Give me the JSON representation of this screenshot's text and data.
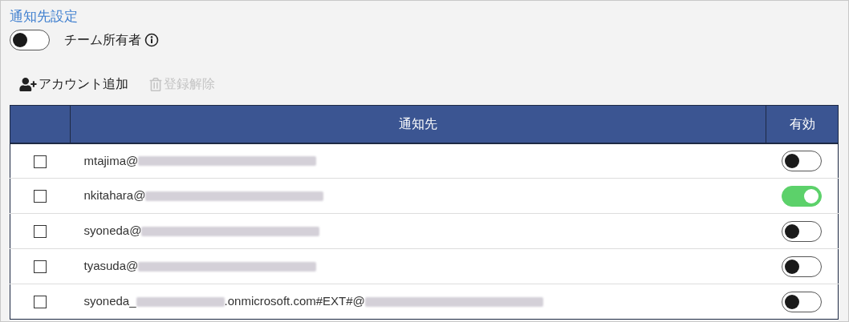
{
  "title": "通知先設定",
  "team_owner": {
    "label": "チーム所有者",
    "on": false
  },
  "toolbar": [
    {
      "label": "アカウント追加",
      "kind": "add",
      "disabled": false
    },
    {
      "label": "登録解除",
      "kind": "delete",
      "disabled": true
    }
  ],
  "table": {
    "columns": [
      "通知先",
      "有効"
    ],
    "rows": [
      {
        "checked": false,
        "address": [
          {
            "kind": "text",
            "text": "mtajima@"
          },
          {
            "kind": "redacted"
          }
        ],
        "enabled": false
      },
      {
        "checked": false,
        "address": [
          {
            "kind": "text",
            "text": "nkitahara@"
          },
          {
            "kind": "redacted"
          }
        ],
        "enabled": true
      },
      {
        "checked": false,
        "address": [
          {
            "kind": "text",
            "text": "syoneda@"
          },
          {
            "kind": "redacted"
          }
        ],
        "enabled": false
      },
      {
        "checked": false,
        "address": [
          {
            "kind": "text",
            "text": "tyasuda@"
          },
          {
            "kind": "redacted"
          }
        ],
        "enabled": false
      },
      {
        "checked": false,
        "address": [
          {
            "kind": "text",
            "text": "syoneda_"
          },
          {
            "kind": "redacted"
          },
          {
            "kind": "text",
            "text": ".onmicrosoft.com#EXT#@"
          },
          {
            "kind": "redacted"
          }
        ],
        "enabled": false
      }
    ]
  }
}
